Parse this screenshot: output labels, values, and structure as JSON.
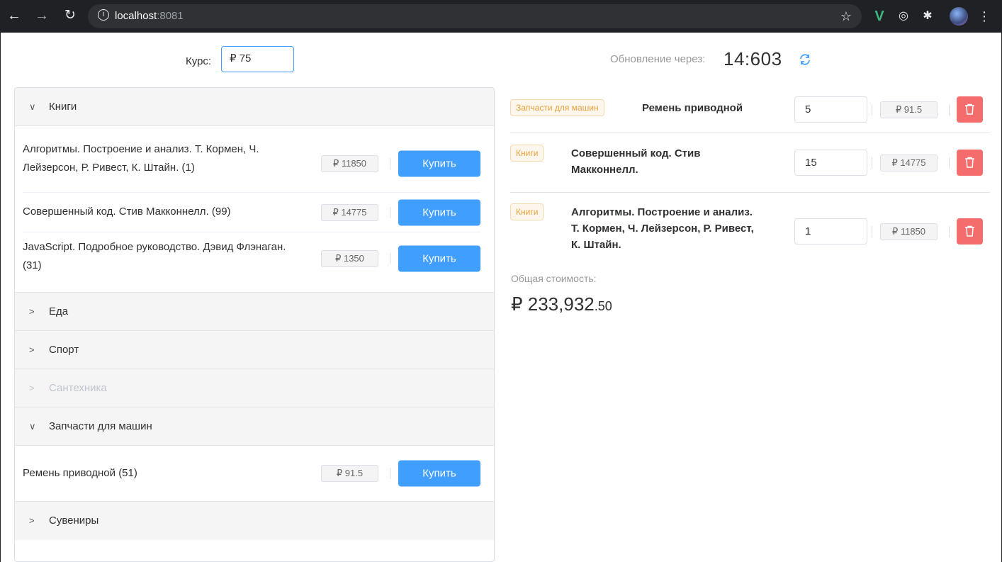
{
  "browser": {
    "url_host": "localhost",
    "url_port": ":8081"
  },
  "top": {
    "rate_label": "Курс:",
    "rate_value": "₽ 75",
    "update_label": "Обновление через:",
    "timer": "14:603"
  },
  "categories": [
    {
      "name": "Книги",
      "expanded": true,
      "items": [
        {
          "title": "Алгоритмы. Построение и анализ. Т. Кормен, Ч. Лейзерсон, Р. Ривест, К. Штайн. (1)",
          "price": "₽ 11850",
          "button": "Купить"
        },
        {
          "title": "Совершенный код. Стив Макконнелл. (99)",
          "price": "₽ 14775",
          "button": "Купить"
        },
        {
          "title": "JavaScript. Подробное руководство. Дэвид Флэнаган. (31)",
          "price": "₽ 1350",
          "button": "Купить"
        }
      ]
    },
    {
      "name": "Еда",
      "expanded": false
    },
    {
      "name": "Спорт",
      "expanded": false
    },
    {
      "name": "Сантехника",
      "expanded": false,
      "disabled": true
    },
    {
      "name": "Запчасти для машин",
      "expanded": true,
      "items": [
        {
          "title": "Ремень приводной (51)",
          "price": "₽ 91.5",
          "button": "Купить"
        }
      ]
    },
    {
      "name": "Сувениры",
      "expanded": false
    }
  ],
  "cart": {
    "rows": [
      {
        "tag": "Запчасти для машин",
        "name": "Ремень приводной",
        "qty": "5",
        "price": "₽ 91.5"
      },
      {
        "tag": "Книги",
        "name": "Совершенный код. Стив Макконнелл.",
        "qty": "15",
        "price": "₽ 14775"
      },
      {
        "tag": "Книги",
        "name": "Алгоритмы. Построение и анализ. Т. Кормен, Ч. Лейзерсон, Р. Ривест, К. Штайн.",
        "qty": "1",
        "price": "₽ 11850"
      }
    ],
    "total_label": "Общая стоимость:",
    "total_main": "₽ 233,932",
    "total_cents": ".50"
  },
  "colors": {
    "primary": "#409eff",
    "danger": "#f56c6c",
    "warning": "#e6a23c"
  }
}
